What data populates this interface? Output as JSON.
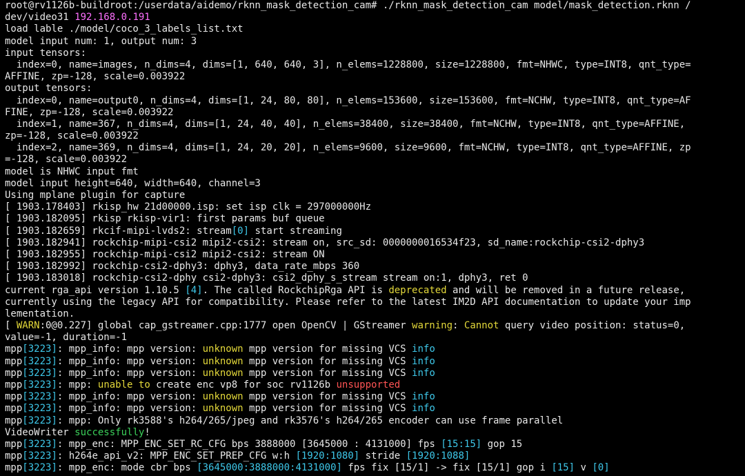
{
  "colors": {
    "background": "#000000",
    "text": "#e8e8e8",
    "magenta": "#ff70ff",
    "cyan": "#3ec8ea",
    "yellow": "#e3d83a",
    "red": "#ff5454",
    "green": "#3bd15a"
  },
  "terminal": {
    "lines": [
      [
        {
          "t": "root@rv1126b-buildroot:/userdata/aidemo/rknn_mask_detection_cam# ./rknn_mask_detection_cam model/mask_detection.rknn /",
          "c": "white"
        }
      ],
      [
        {
          "t": "dev/video31 ",
          "c": "white"
        },
        {
          "t": "192.168.0.191",
          "c": "magenta"
        }
      ],
      [
        {
          "t": "load lable ./model/coco_3_labels_list.txt",
          "c": "white"
        }
      ],
      [
        {
          "t": "model input num: 1, output num: 3",
          "c": "white"
        }
      ],
      [
        {
          "t": "input tensors:",
          "c": "white"
        }
      ],
      [
        {
          "t": "  index=0, name=images, n_dims=4, dims=[1, 640, 640, 3], n_elems=1228800, size=1228800, fmt=NHWC, type=INT8, qnt_type=",
          "c": "white"
        }
      ],
      [
        {
          "t": "AFFINE, zp=-128, scale=0.003922",
          "c": "white"
        }
      ],
      [
        {
          "t": "output tensors:",
          "c": "white"
        }
      ],
      [
        {
          "t": "  index=0, name=output0, n_dims=4, dims=[1, 24, 80, 80], n_elems=153600, size=153600, fmt=NCHW, type=INT8, qnt_type=AF",
          "c": "white"
        }
      ],
      [
        {
          "t": "FINE, zp=-128, scale=0.003922",
          "c": "white"
        }
      ],
      [
        {
          "t": "  index=1, name=367, n_dims=4, dims=[1, 24, 40, 40], n_elems=38400, size=38400, fmt=NCHW, type=INT8, qnt_type=AFFINE,",
          "c": "white"
        }
      ],
      [
        {
          "t": "zp=-128, scale=0.003922",
          "c": "white"
        }
      ],
      [
        {
          "t": "  index=2, name=369, n_dims=4, dims=[1, 24, 20, 20], n_elems=9600, size=9600, fmt=NCHW, type=INT8, qnt_type=AFFINE, zp",
          "c": "white"
        }
      ],
      [
        {
          "t": "=-128, scale=0.003922",
          "c": "white"
        }
      ],
      [
        {
          "t": "model is NHWC input fmt",
          "c": "white"
        }
      ],
      [
        {
          "t": "model input height=640, width=640, channel=3",
          "c": "white"
        }
      ],
      [
        {
          "t": "Using mplane plugin for capture",
          "c": "white"
        }
      ],
      [
        {
          "t": "[ 1903.178403] rkisp_hw 21d00000.isp: set isp clk = 297000000Hz",
          "c": "white"
        }
      ],
      [
        {
          "t": "[ 1903.182095] rkisp rkisp-vir1: first params buf queue",
          "c": "white"
        }
      ],
      [
        {
          "t": "[ 1903.182659] rkcif-mipi-lvds2: stream",
          "c": "white"
        },
        {
          "t": "[0]",
          "c": "cyan"
        },
        {
          "t": " start streaming",
          "c": "white"
        }
      ],
      [
        {
          "t": "[ 1903.182941] rockchip-mipi-csi2 mipi2-csi2: stream on, src_sd: 0000000016534f23, sd_name:rockchip-csi2-dphy3",
          "c": "white"
        }
      ],
      [
        {
          "t": "[ 1903.182955] rockchip-mipi-csi2 mipi2-csi2: stream ON",
          "c": "white"
        }
      ],
      [
        {
          "t": "[ 1903.182992] rockchip-csi2-dphy3: dphy3, data_rate_mbps 360",
          "c": "white"
        }
      ],
      [
        {
          "t": "[ 1903.183018] rockchip-csi2-dphy csi2-dphy3: csi2_dphy_s_stream stream on:1, dphy3, ret 0",
          "c": "white"
        }
      ],
      [
        {
          "t": "current rga_api version 1.10.5 ",
          "c": "white"
        },
        {
          "t": "[4]",
          "c": "cyan"
        },
        {
          "t": ". The called RockchipRga API is ",
          "c": "white"
        },
        {
          "t": "deprecated",
          "c": "yellow"
        },
        {
          "t": " and will be removed in a future release,",
          "c": "white"
        }
      ],
      [
        {
          "t": "currently using the legacy API for compatibility. Please refer to the latest IM2D API documentation to update your imp",
          "c": "white"
        }
      ],
      [
        {
          "t": "lementation.",
          "c": "white"
        }
      ],
      [
        {
          "t": "[ ",
          "c": "white"
        },
        {
          "t": "WARN",
          "c": "yellow"
        },
        {
          "t": ":0@0.227] global cap_gstreamer.cpp:1777 open OpenCV | GStreamer ",
          "c": "white"
        },
        {
          "t": "warning",
          "c": "yellow"
        },
        {
          "t": ": ",
          "c": "white"
        },
        {
          "t": "Cannot",
          "c": "yellow"
        },
        {
          "t": " query video position: status=0,",
          "c": "white"
        }
      ],
      [
        {
          "t": "value=-1, duration=-1",
          "c": "white"
        }
      ],
      [
        {
          "t": "mpp",
          "c": "white"
        },
        {
          "t": "[3223]",
          "c": "cyan"
        },
        {
          "t": ": mpp_info: mpp version: ",
          "c": "white"
        },
        {
          "t": "unknown",
          "c": "yellow"
        },
        {
          "t": " mpp version for missing VCS ",
          "c": "white"
        },
        {
          "t": "info",
          "c": "cyan"
        }
      ],
      [
        {
          "t": "mpp",
          "c": "white"
        },
        {
          "t": "[3223]",
          "c": "cyan"
        },
        {
          "t": ": mpp_info: mpp version: ",
          "c": "white"
        },
        {
          "t": "unknown",
          "c": "yellow"
        },
        {
          "t": " mpp version for missing VCS ",
          "c": "white"
        },
        {
          "t": "info",
          "c": "cyan"
        }
      ],
      [
        {
          "t": "mpp",
          "c": "white"
        },
        {
          "t": "[3223]",
          "c": "cyan"
        },
        {
          "t": ": mpp_info: mpp version: ",
          "c": "white"
        },
        {
          "t": "unknown",
          "c": "yellow"
        },
        {
          "t": " mpp version for missing VCS ",
          "c": "white"
        },
        {
          "t": "info",
          "c": "cyan"
        }
      ],
      [
        {
          "t": "mpp",
          "c": "white"
        },
        {
          "t": "[3223]",
          "c": "cyan"
        },
        {
          "t": ": mpp: ",
          "c": "white"
        },
        {
          "t": "unable to",
          "c": "yellow"
        },
        {
          "t": " create enc vp8 for soc rv1126b ",
          "c": "white"
        },
        {
          "t": "unsupported",
          "c": "red"
        }
      ],
      [
        {
          "t": "mpp",
          "c": "white"
        },
        {
          "t": "[3223]",
          "c": "cyan"
        },
        {
          "t": ": mpp_info: mpp version: ",
          "c": "white"
        },
        {
          "t": "unknown",
          "c": "yellow"
        },
        {
          "t": " mpp version for missing VCS ",
          "c": "white"
        },
        {
          "t": "info",
          "c": "cyan"
        }
      ],
      [
        {
          "t": "mpp",
          "c": "white"
        },
        {
          "t": "[3223]",
          "c": "cyan"
        },
        {
          "t": ": mpp_info: mpp version: ",
          "c": "white"
        },
        {
          "t": "unknown",
          "c": "yellow"
        },
        {
          "t": " mpp version for missing VCS ",
          "c": "white"
        },
        {
          "t": "info",
          "c": "cyan"
        }
      ],
      [
        {
          "t": "mpp",
          "c": "white"
        },
        {
          "t": "[3223]",
          "c": "cyan"
        },
        {
          "t": ": mpp: Only rk3588's h264/265/jpeg and rk3576's h264/265 encoder can use frame parallel",
          "c": "white"
        }
      ],
      [
        {
          "t": "VideoWriter ",
          "c": "white"
        },
        {
          "t": "successfully",
          "c": "green"
        },
        {
          "t": "!",
          "c": "white"
        }
      ],
      [
        {
          "t": "mpp",
          "c": "white"
        },
        {
          "t": "[3223]",
          "c": "cyan"
        },
        {
          "t": ": mpp_enc: MPP_ENC_SET_RC_CFG bps 3888000 [3645000 : 4131000] fps ",
          "c": "white"
        },
        {
          "t": "[15:15]",
          "c": "cyan"
        },
        {
          "t": " gop 15",
          "c": "white"
        }
      ],
      [
        {
          "t": "mpp",
          "c": "white"
        },
        {
          "t": "[3223]",
          "c": "cyan"
        },
        {
          "t": ": h264e_api_v2: MPP_ENC_SET_PREP_CFG w:h ",
          "c": "white"
        },
        {
          "t": "[1920:1080]",
          "c": "cyan"
        },
        {
          "t": " stride ",
          "c": "white"
        },
        {
          "t": "[1920:1088]",
          "c": "cyan"
        }
      ],
      [
        {
          "t": "mpp",
          "c": "white"
        },
        {
          "t": "[3223]",
          "c": "cyan"
        },
        {
          "t": ": mpp_enc: mode cbr bps ",
          "c": "white"
        },
        {
          "t": "[3645000:3888000:4131000]",
          "c": "cyan"
        },
        {
          "t": " fps fix [15/1] -> fix [15/1] gop i ",
          "c": "white"
        },
        {
          "t": "[15]",
          "c": "cyan"
        },
        {
          "t": " v ",
          "c": "white"
        },
        {
          "t": "[0]",
          "c": "cyan"
        }
      ]
    ]
  }
}
